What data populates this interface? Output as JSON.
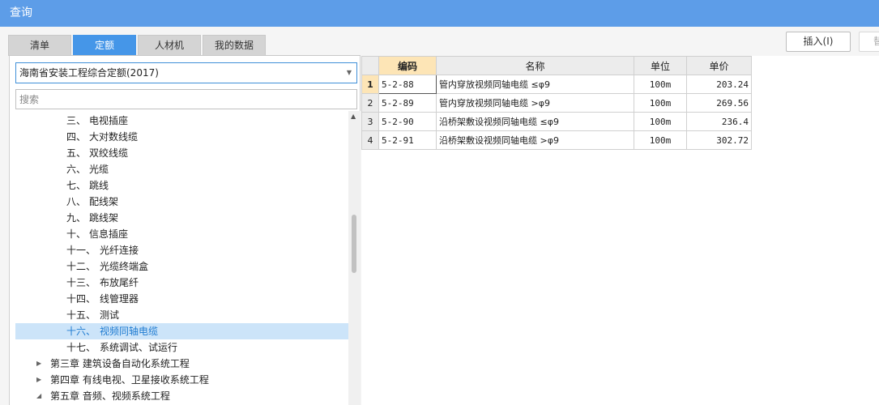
{
  "window": {
    "title": "查询"
  },
  "tabs": [
    {
      "label": "清单",
      "active": false
    },
    {
      "label": "定额",
      "active": true
    },
    {
      "label": "人材机",
      "active": false
    },
    {
      "label": "我的数据",
      "active": false
    }
  ],
  "toolbar": {
    "insert_label": "插入(I)",
    "more_label": "替"
  },
  "left": {
    "library_select": "海南省安装工程综合定额(2017)",
    "search_placeholder": "搜索",
    "tree": [
      {
        "num": "三、",
        "label": "电视插座"
      },
      {
        "num": "四、",
        "label": "大对数线缆"
      },
      {
        "num": "五、",
        "label": "双绞线缆"
      },
      {
        "num": "六、",
        "label": "光缆"
      },
      {
        "num": "七、",
        "label": "跳线"
      },
      {
        "num": "八、",
        "label": "配线架"
      },
      {
        "num": "九、",
        "label": "跳线架"
      },
      {
        "num": "十、",
        "label": "信息插座"
      },
      {
        "num": "十一、",
        "label": "光纤连接"
      },
      {
        "num": "十二、",
        "label": "光缆终端盒"
      },
      {
        "num": "十三、",
        "label": "布放尾纤"
      },
      {
        "num": "十四、",
        "label": "线管理器"
      },
      {
        "num": "十五、",
        "label": "测试"
      },
      {
        "num": "十六、",
        "label": "视频同轴电缆",
        "selected": true
      },
      {
        "num": "十七、",
        "label": "系统调试、试运行"
      },
      {
        "chapter": "第三章 建筑设备自动化系统工程",
        "expander": "▶"
      },
      {
        "chapter": "第四章 有线电视、卫星接收系统工程",
        "expander": "▶"
      },
      {
        "chapter": "第五章 音频、视频系统工程",
        "expander": "◢"
      }
    ]
  },
  "grid": {
    "columns": [
      "编码",
      "名称",
      "单位",
      "单价"
    ],
    "rows": [
      {
        "idx": "1",
        "code": "5-2-88",
        "name": "管内穿放视频同轴电缆 ≤φ9",
        "unit": "100m",
        "price": "203.24"
      },
      {
        "idx": "2",
        "code": "5-2-89",
        "name": "管内穿放视频同轴电缆 >φ9",
        "unit": "100m",
        "price": "269.56"
      },
      {
        "idx": "3",
        "code": "5-2-90",
        "name": "沿桥架敷设视频同轴电缆 ≤φ9",
        "unit": "100m",
        "price": "236.4"
      },
      {
        "idx": "4",
        "code": "5-2-91",
        "name": "沿桥架敷设视频同轴电缆 >φ9",
        "unit": "100m",
        "price": "302.72"
      }
    ]
  }
}
